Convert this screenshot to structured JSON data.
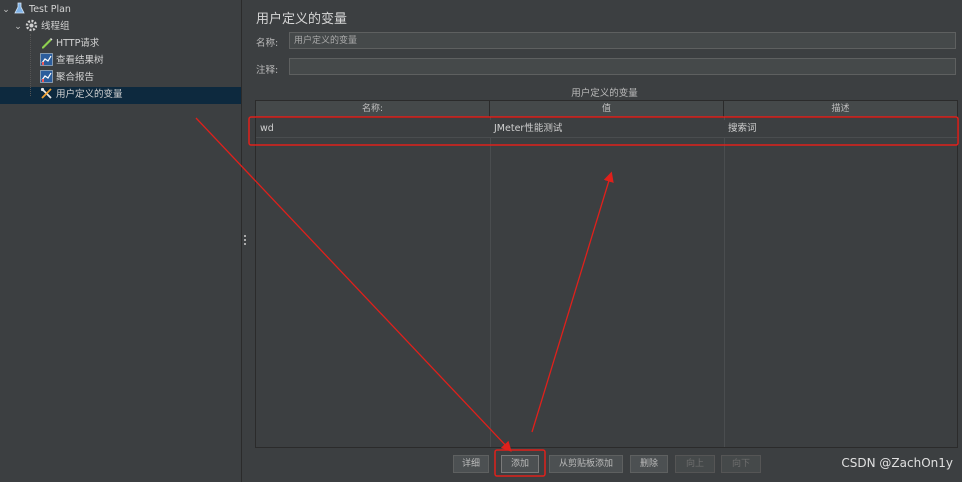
{
  "tree": {
    "items": [
      {
        "label": "Test Plan",
        "icon": "flask-icon",
        "expanded": true
      },
      {
        "label": "线程组",
        "icon": "gear-icon",
        "expanded": true
      },
      {
        "label": "HTTP请求",
        "icon": "pen-icon"
      },
      {
        "label": "查看结果树",
        "icon": "chart-icon"
      },
      {
        "label": "聚合报告",
        "icon": "chart-icon"
      },
      {
        "label": "用户定义的变量",
        "icon": "tools-icon",
        "selected": true
      }
    ]
  },
  "panel": {
    "title": "用户定义的变量",
    "name_label": "名称:",
    "name_value": "用户定义的变量",
    "comment_label": "注释:",
    "comment_value": "",
    "section_title": "用户定义的变量"
  },
  "table": {
    "headers": [
      "名称:",
      "值",
      "描述"
    ],
    "rows": [
      {
        "name": "wd",
        "value": "JMeter性能测试",
        "description": "搜索词"
      }
    ]
  },
  "buttons": {
    "detail": "详细",
    "add": "添加",
    "add_from_clipboard": "从剪贴板添加",
    "delete": "删除",
    "up": "向上",
    "down": "向下"
  },
  "watermark": "CSDN @ZachOn1y",
  "colors": {
    "background": "#3c3f41",
    "selection": "#2f65ca",
    "annotation": "#e0201b"
  }
}
